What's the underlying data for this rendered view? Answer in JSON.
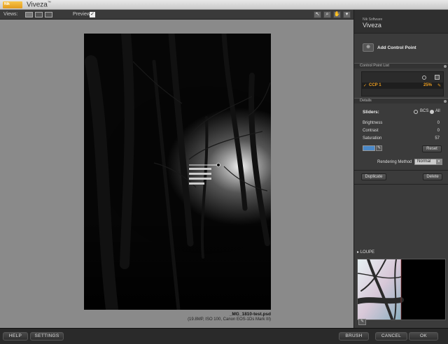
{
  "window": {
    "title": "Viveza",
    "tm": "™",
    "logo_text": "Nik"
  },
  "toolbar": {
    "views_label": "Views:",
    "preview_label": "Preview:",
    "preview_checked": "✓"
  },
  "file": {
    "name": "_MG_1810-test.psd",
    "meta": "(19.8MP, ISO 100, Canon EOS-1Ds Mark III)"
  },
  "panel": {
    "company": "Nik Software",
    "product": "Viveza",
    "add_control_point": "Add Control Point",
    "control_point_list_title": "Control Point List",
    "control_point": {
      "name": "CCP 1",
      "opacity": "25%"
    },
    "details_title": "Details",
    "sliders_label": "Sliders:",
    "slider_modes": [
      "BCS",
      "All"
    ],
    "parameters": [
      {
        "label": "Brightness",
        "value": "0"
      },
      {
        "label": "Contrast",
        "value": "0"
      },
      {
        "label": "Saturation",
        "value": "57"
      }
    ],
    "reset_label": "Reset",
    "rendering_method_label": "Rendering Method",
    "rendering_method_value": "Normal",
    "duplicate_label": "Duplicate",
    "delete_label": "Delete",
    "loupe_label": "LOUPE"
  },
  "bottom": {
    "help": "HELP",
    "settings": "SETTINGS",
    "brush": "BRUSH",
    "cancel": "CANCEL",
    "ok": "OK"
  },
  "colors": {
    "accent": "#f0a020",
    "canvas": "#8a8a8a",
    "panel": "#3b3b3b",
    "swatch": "#4a88c8"
  }
}
